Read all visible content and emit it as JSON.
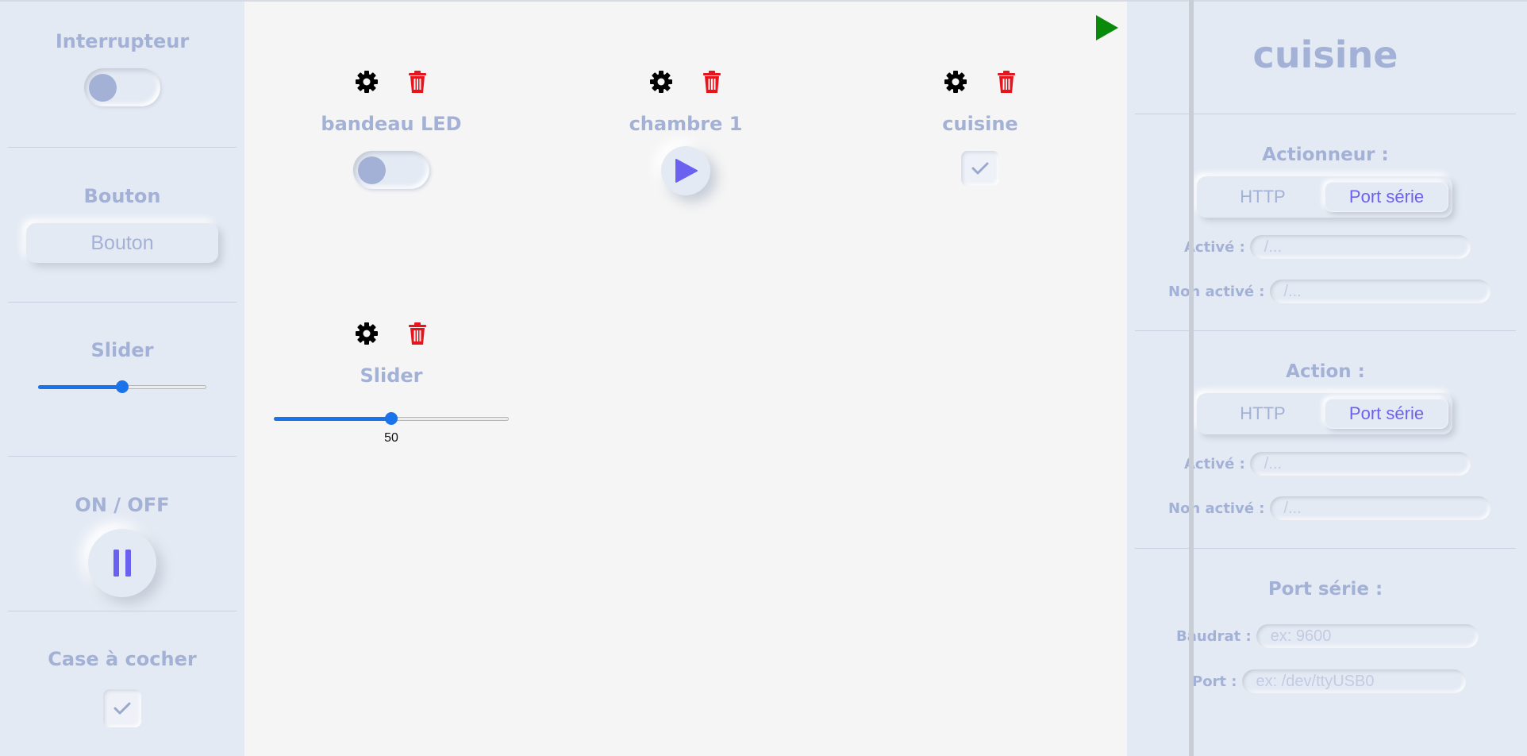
{
  "palette": {
    "items": [
      {
        "label": "Interrupteur"
      },
      {
        "label": "Bouton",
        "button_label": "Bouton"
      },
      {
        "label": "Slider",
        "value_fraction": 0.5
      },
      {
        "label": "ON / OFF"
      },
      {
        "label": "Case à cocher"
      }
    ]
  },
  "canvas": {
    "widgets": [
      {
        "title": "bandeau LED",
        "type": "toggle"
      },
      {
        "title": "chambre 1",
        "type": "play-button"
      },
      {
        "title": "cuisine",
        "type": "checkbox"
      },
      {
        "title": "Slider",
        "type": "slider",
        "value": "50",
        "value_fraction": 0.5
      }
    ]
  },
  "panel": {
    "title": "cuisine",
    "actionneur": {
      "heading": "Actionneur :",
      "options": [
        "HTTP",
        "Port série"
      ],
      "selected": "Port série",
      "active_label": "Activé :",
      "active_placeholder": "/...",
      "inactive_label": "Non activé :",
      "inactive_placeholder": "/..."
    },
    "action": {
      "heading": "Action :",
      "options": [
        "HTTP",
        "Port série"
      ],
      "selected": "Port série",
      "active_label": "Activé :",
      "active_placeholder": "/...",
      "inactive_label": "Non activé :",
      "inactive_placeholder": "/..."
    },
    "serial": {
      "heading": "Port série :",
      "baudrate_label": "Baudrat :",
      "baudrate_placeholder": "ex: 9600",
      "port_label": "Port :",
      "port_placeholder": "ex: /dev/ttyUSB0"
    }
  },
  "colors": {
    "accent": "#6b61f0",
    "label": "#a3b1d6",
    "delete": "#e8141c",
    "run": "#0a8a0a",
    "slider": "#1a73e8"
  }
}
